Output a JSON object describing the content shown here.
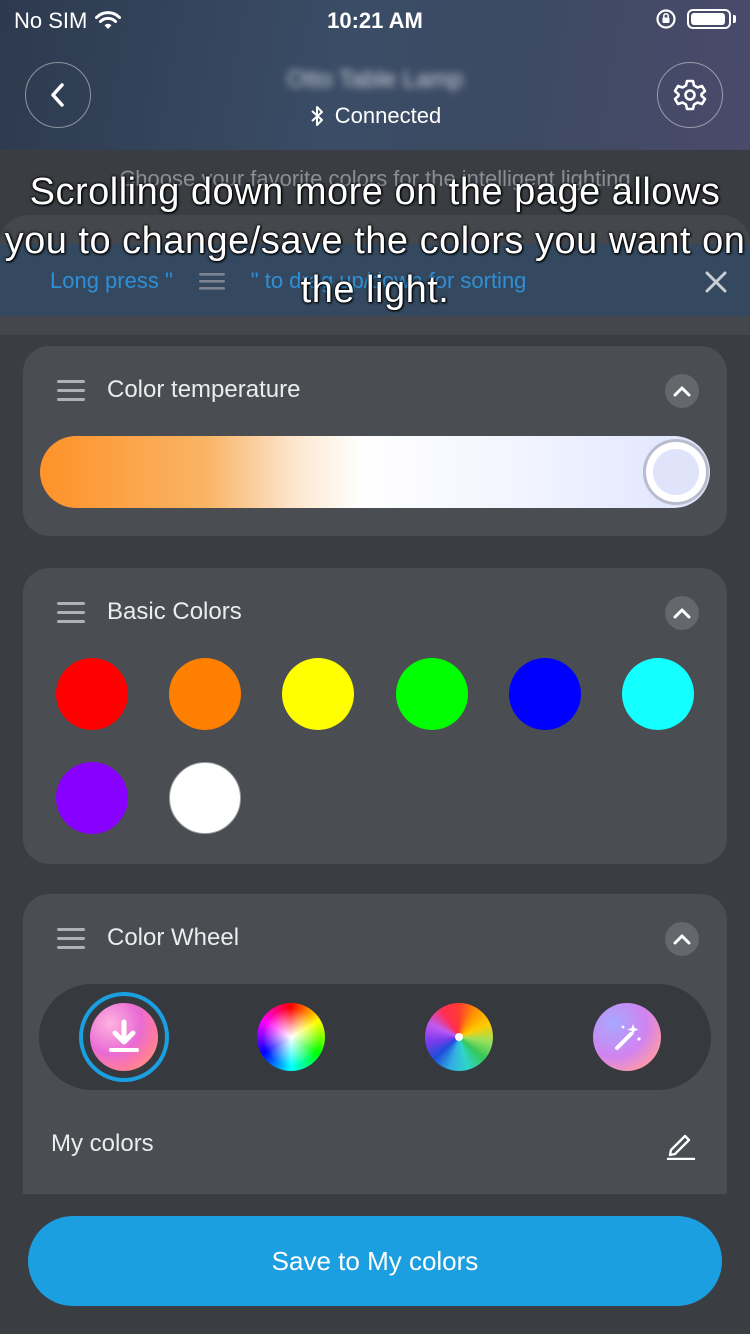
{
  "status_bar": {
    "carrier": "No SIM",
    "time": "10:21 AM"
  },
  "header": {
    "device_name": "Otto Table Lamp",
    "connection_status": "Connected"
  },
  "hint_text": "Choose your favorite colors for the intelligent lighting",
  "banner": {
    "text_before": "Long press \"",
    "text_after": "\" to drag up/down for sorting"
  },
  "overlay_caption": "Scrolling down more on the page allows you to change/save the colors you want on the light.",
  "color_temperature": {
    "title": "Color temperature",
    "slider_value": 1.0,
    "gradient": [
      "#ff9228",
      "#ffffff",
      "#dfe4ff"
    ]
  },
  "basic_colors": {
    "title": "Basic Colors",
    "swatches": [
      "#ff0000",
      "#ff7f00",
      "#ffff00",
      "#00ff00",
      "#0000ff",
      "#14ffff",
      "#8800ff",
      "#ffffff"
    ]
  },
  "color_wheel": {
    "title": "Color Wheel",
    "modes": [
      "download-icon",
      "color-wheel-smooth-icon",
      "color-wheel-segmented-icon",
      "magic-wand-icon"
    ],
    "selected_mode": "download-icon",
    "my_colors_label": "My colors"
  },
  "save_button": "Save to My colors",
  "colors": {
    "accent": "#1b9fe1",
    "card": "#4a4d52",
    "background": "#3a3d42"
  }
}
